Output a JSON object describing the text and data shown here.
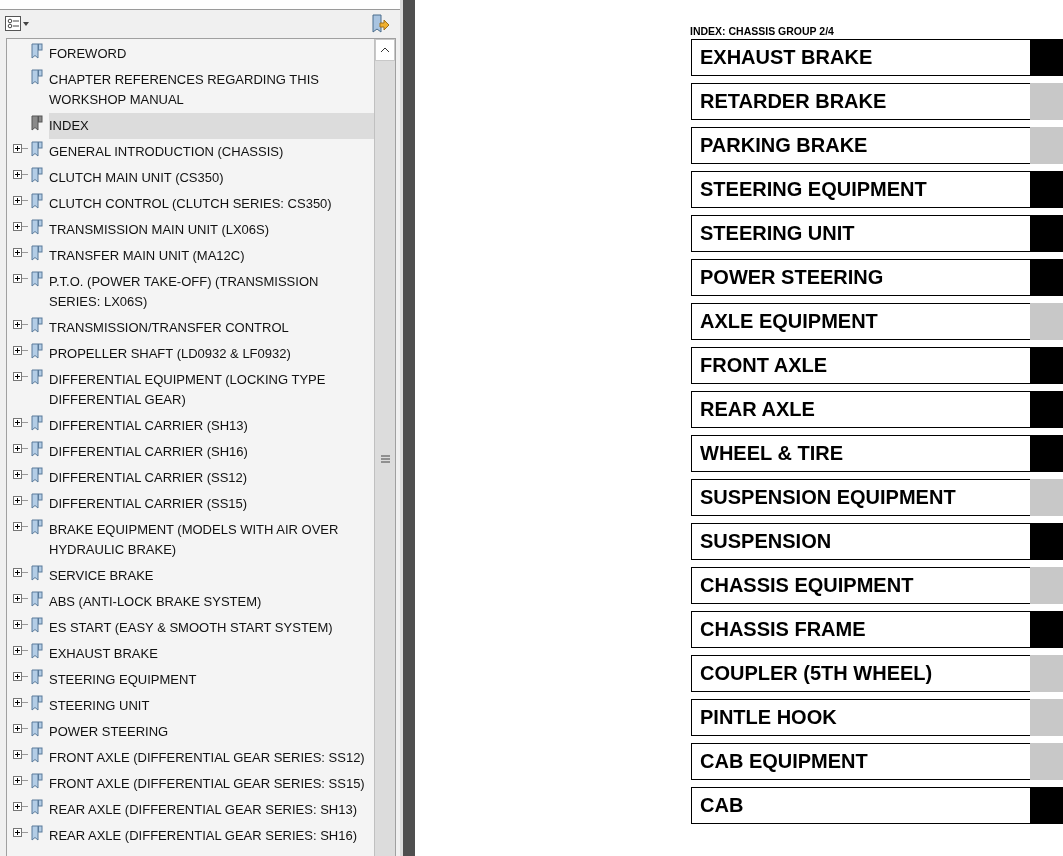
{
  "bookmarks_panel": {
    "items": [
      {
        "label": "FOREWORD",
        "expandable": false,
        "selected": false
      },
      {
        "label": "CHAPTER REFERENCES REGARDING THIS WORKSHOP MANUAL",
        "expandable": false,
        "selected": false
      },
      {
        "label": "INDEX",
        "expandable": false,
        "selected": true
      },
      {
        "label": "GENERAL INTRODUCTION (CHASSIS)",
        "expandable": true,
        "selected": false
      },
      {
        "label": "CLUTCH MAIN UNIT (CS350)",
        "expandable": true,
        "selected": false
      },
      {
        "label": "CLUTCH CONTROL (CLUTCH SERIES: CS350)",
        "expandable": true,
        "selected": false
      },
      {
        "label": "TRANSMISSION MAIN UNIT (LX06S)",
        "expandable": true,
        "selected": false
      },
      {
        "label": "TRANSFER MAIN UNIT (MA12C)",
        "expandable": true,
        "selected": false
      },
      {
        "label": "P.T.O. (POWER TAKE-OFF) (TRANSMISSION SERIES: LX06S)",
        "expandable": true,
        "selected": false
      },
      {
        "label": "TRANSMISSION/TRANSFER CONTROL",
        "expandable": true,
        "selected": false
      },
      {
        "label": "PROPELLER SHAFT (LD0932 & LF0932)",
        "expandable": true,
        "selected": false
      },
      {
        "label": "DIFFERENTIAL EQUIPMENT (LOCKING TYPE DIFFERENTIAL GEAR)",
        "expandable": true,
        "selected": false
      },
      {
        "label": "DIFFERENTIAL CARRIER (SH13)",
        "expandable": true,
        "selected": false
      },
      {
        "label": "DIFFERENTIAL CARRIER (SH16)",
        "expandable": true,
        "selected": false
      },
      {
        "label": "DIFFERENTIAL CARRIER (SS12)",
        "expandable": true,
        "selected": false
      },
      {
        "label": "DIFFERENTIAL CARRIER (SS15)",
        "expandable": true,
        "selected": false
      },
      {
        "label": "BRAKE EQUIPMENT (MODELS WITH AIR OVER HYDRAULIC BRAKE)",
        "expandable": true,
        "selected": false
      },
      {
        "label": "SERVICE BRAKE",
        "expandable": true,
        "selected": false
      },
      {
        "label": "ABS (ANTI-LOCK BRAKE SYSTEM)",
        "expandable": true,
        "selected": false
      },
      {
        "label": "ES START (EASY & SMOOTH START SYSTEM)",
        "expandable": true,
        "selected": false
      },
      {
        "label": "EXHAUST BRAKE",
        "expandable": true,
        "selected": false
      },
      {
        "label": "STEERING EQUIPMENT",
        "expandable": true,
        "selected": false
      },
      {
        "label": "STEERING UNIT",
        "expandable": true,
        "selected": false
      },
      {
        "label": "POWER STEERING",
        "expandable": true,
        "selected": false
      },
      {
        "label": "FRONT AXLE (DIFFERENTIAL GEAR SERIES: SS12)",
        "expandable": true,
        "selected": false
      },
      {
        "label": "FRONT AXLE (DIFFERENTIAL GEAR SERIES: SS15)",
        "expandable": true,
        "selected": false
      },
      {
        "label": "REAR AXLE (DIFFERENTIAL GEAR SERIES: SH13)",
        "expandable": true,
        "selected": false
      },
      {
        "label": "REAR AXLE (DIFFERENTIAL GEAR SERIES: SH16)",
        "expandable": true,
        "selected": false
      }
    ]
  },
  "page": {
    "header": "INDEX: CHASSIS GROUP 2/4",
    "sections": [
      {
        "label": "EXHAUST BRAKE",
        "color": "#000000"
      },
      {
        "label": "RETARDER BRAKE",
        "color": "#c8c8c8"
      },
      {
        "label": "PARKING BRAKE",
        "color": "#c8c8c8"
      },
      {
        "label": "STEERING EQUIPMENT",
        "color": "#000000"
      },
      {
        "label": "STEERING UNIT",
        "color": "#000000"
      },
      {
        "label": "POWER STEERING",
        "color": "#000000"
      },
      {
        "label": "AXLE EQUIPMENT",
        "color": "#c8c8c8"
      },
      {
        "label": "FRONT AXLE",
        "color": "#000000"
      },
      {
        "label": "REAR AXLE",
        "color": "#000000"
      },
      {
        "label": "WHEEL & TIRE",
        "color": "#000000"
      },
      {
        "label": "SUSPENSION EQUIPMENT",
        "color": "#c8c8c8"
      },
      {
        "label": "SUSPENSION",
        "color": "#000000"
      },
      {
        "label": "CHASSIS EQUIPMENT",
        "color": "#c8c8c8"
      },
      {
        "label": "CHASSIS FRAME",
        "color": "#000000"
      },
      {
        "label": "COUPLER (5TH WHEEL)",
        "color": "#c8c8c8"
      },
      {
        "label": "PINTLE HOOK",
        "color": "#c8c8c8"
      },
      {
        "label": "CAB EQUIPMENT",
        "color": "#c8c8c8"
      },
      {
        "label": "CAB",
        "color": "#000000"
      }
    ]
  }
}
